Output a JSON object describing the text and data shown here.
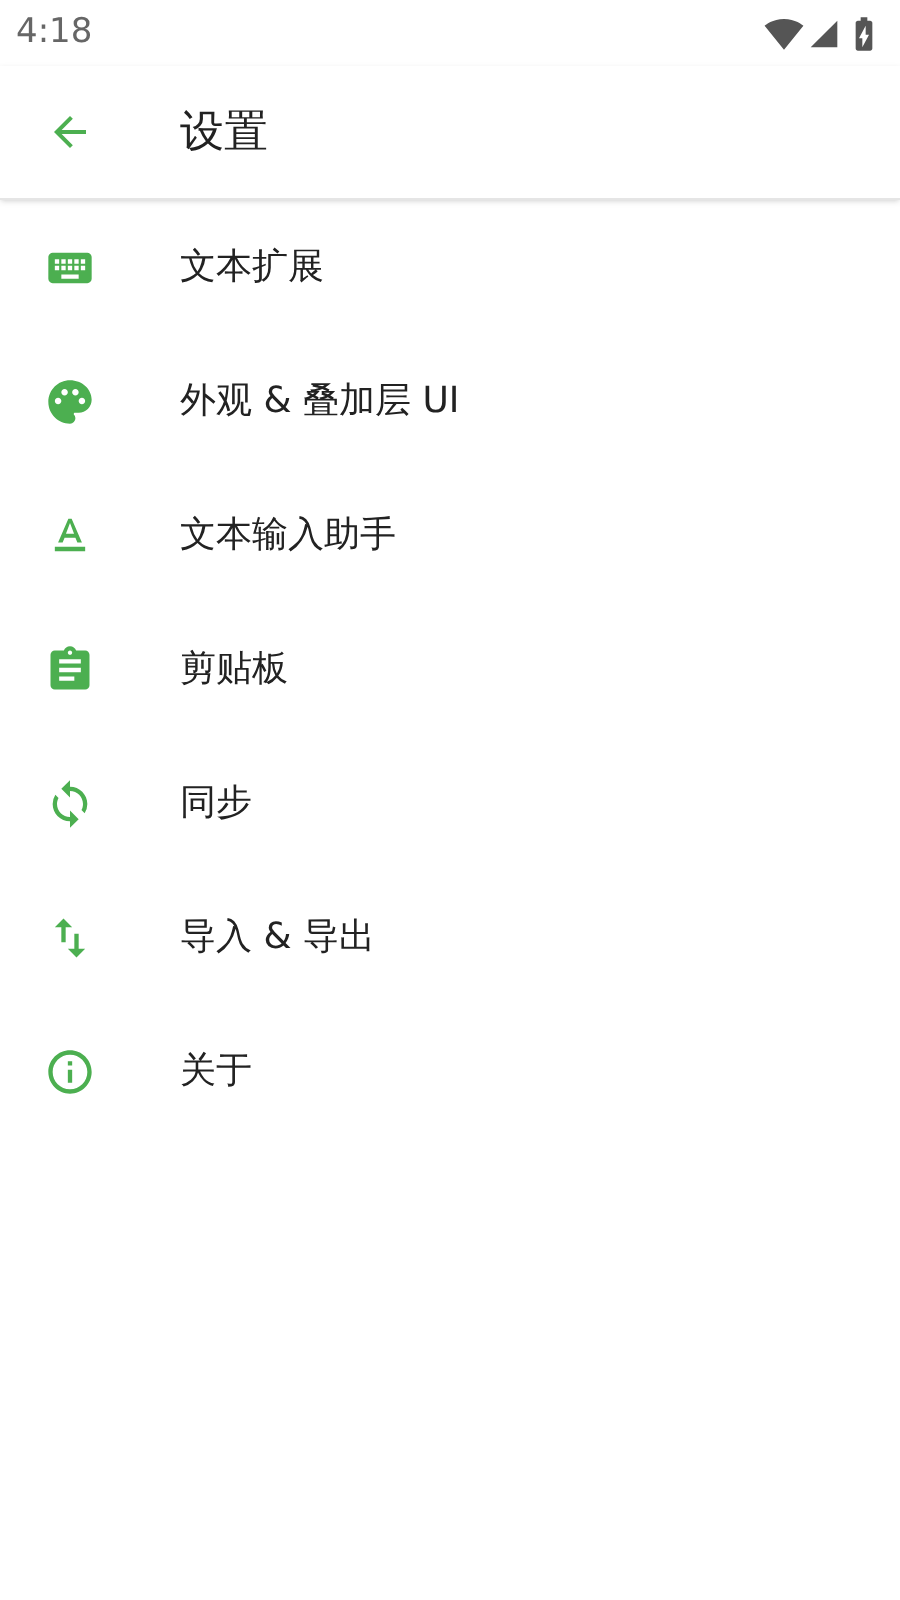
{
  "status_bar": {
    "time": "4:18"
  },
  "app_bar": {
    "title": "设置"
  },
  "items": [
    {
      "kind": "keyboard",
      "label": "文本扩展"
    },
    {
      "kind": "palette",
      "label": "外观 & 叠加层 UI"
    },
    {
      "kind": "text",
      "label": "文本输入助手"
    },
    {
      "kind": "clipboard",
      "label": "剪贴板"
    },
    {
      "kind": "sync",
      "label": "同步"
    },
    {
      "kind": "transfer",
      "label": "导入 & 导出"
    },
    {
      "kind": "info",
      "label": "关于"
    }
  ]
}
